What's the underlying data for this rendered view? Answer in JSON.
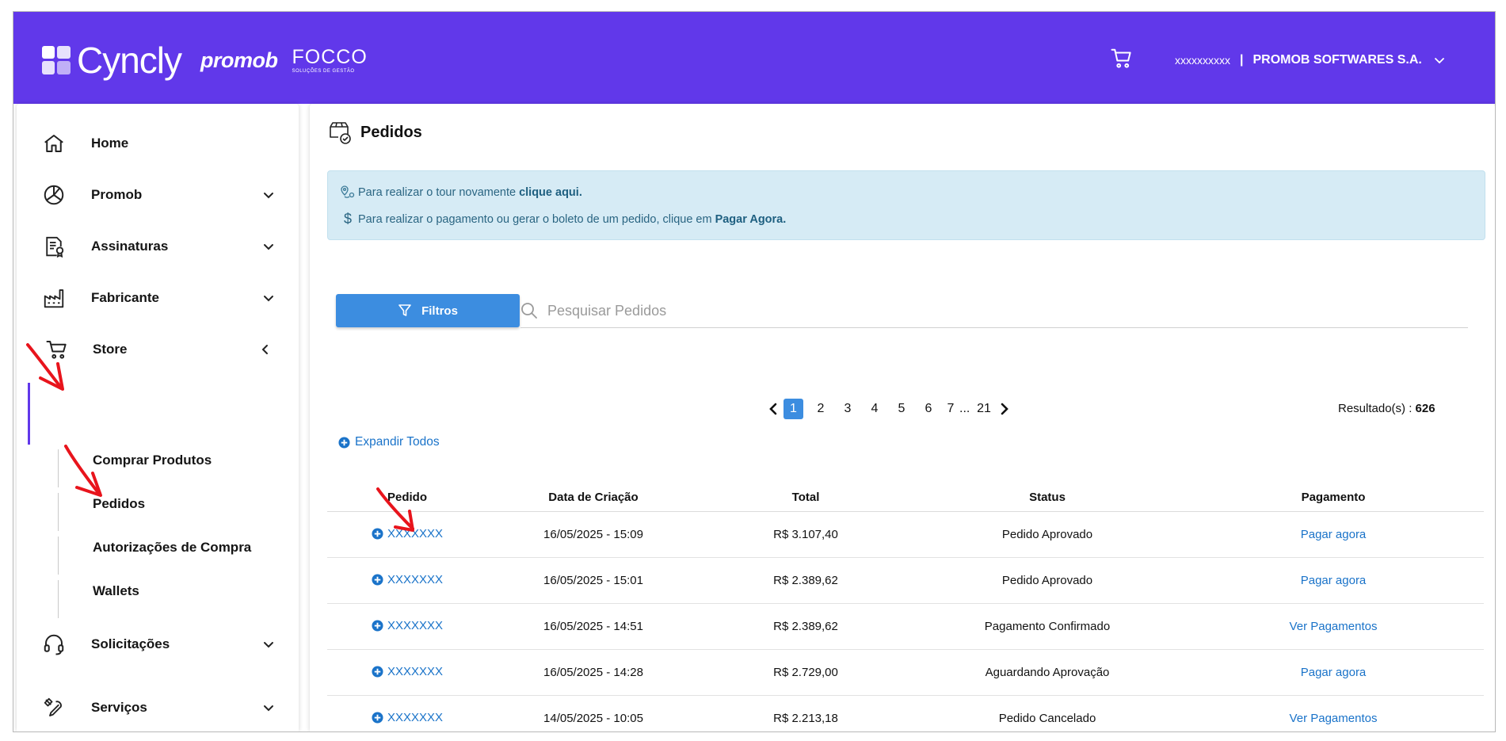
{
  "header": {
    "brand_name": "Cyncly",
    "brand_promob": "promob",
    "brand_focco": "FOCCO",
    "brand_focco_sub": "SOLUÇÕES DE GESTÃO",
    "user_name": "xxxxxxxxxx",
    "separator": "|",
    "company": "PROMOB SOFTWARES S.A.",
    "cart_icon": "cart-icon",
    "chevron_icon": "chevron-down-icon",
    "bar_color": "#6138ea"
  },
  "sidebar": {
    "items": [
      {
        "label": "Home",
        "icon": "home-icon"
      },
      {
        "label": "Promob",
        "icon": "promob-icon"
      },
      {
        "label": "Assinaturas",
        "icon": "document-badge-icon"
      },
      {
        "label": "Fabricante",
        "icon": "factory-icon"
      },
      {
        "label": "Store",
        "icon": "cart-icon"
      },
      {
        "label": "Solicitações",
        "icon": "headset-icon"
      },
      {
        "label": "Serviços",
        "icon": "tools-icon"
      }
    ],
    "store_subitems": [
      "Comprar Produtos",
      "Pedidos",
      "Autorizações de Compra",
      "Wallets"
    ],
    "active_color": "#6138ea"
  },
  "main": {
    "title": "Pedidos",
    "title_icon": "box-check-icon",
    "info": {
      "line1_text": "Para realizar o tour novamente",
      "line1_link": "clique aqui.",
      "line1_icon": "map-pin-icon",
      "line2_text": "Para realizar o pagamento ou gerar o boleto de um pedido, clique em",
      "line2_link": "Pagar Agora.",
      "line2_icon": "dollar-icon"
    },
    "filter_label": "Filtros",
    "filter_icon": "filter-icon",
    "search_placeholder": "Pesquisar Pedidos",
    "pagination": {
      "pages": [
        "1",
        "2",
        "3",
        "4",
        "5",
        "6",
        "7"
      ],
      "ellipsis": "...",
      "last": "21",
      "current": "1"
    },
    "results_label": "Resultado(s) :",
    "results_count": "626",
    "expand_all": "Expandir Todos",
    "table": {
      "headers": [
        "Pedido",
        "Data de Criação",
        "Total",
        "Status",
        "Pagamento"
      ],
      "rows": [
        {
          "pedido": "XXXXXXX",
          "data": "16/05/2025 - 15:09",
          "total": "R$ 3.107,40",
          "status": "Pedido Aprovado",
          "pagamento": "Pagar agora"
        },
        {
          "pedido": "XXXXXXX",
          "data": "16/05/2025 - 15:01",
          "total": "R$ 2.389,62",
          "status": "Pedido Aprovado",
          "pagamento": "Pagar agora"
        },
        {
          "pedido": "XXXXXXX",
          "data": "16/05/2025 - 14:51",
          "total": "R$ 2.389,62",
          "status": "Pagamento Confirmado",
          "pagamento": "Ver Pagamentos"
        },
        {
          "pedido": "XXXXXXX",
          "data": "16/05/2025 - 14:28",
          "total": "R$ 2.729,00",
          "status": "Aguardando Aprovação",
          "pagamento": "Pagar agora"
        },
        {
          "pedido": "XXXXXXX",
          "data": "14/05/2025 - 10:05",
          "total": "R$ 2.213,18",
          "status": "Pedido Cancelado",
          "pagamento": "Ver Pagamentos"
        }
      ]
    },
    "accent_color": "#3c8de0",
    "link_color": "#1a73c9"
  }
}
